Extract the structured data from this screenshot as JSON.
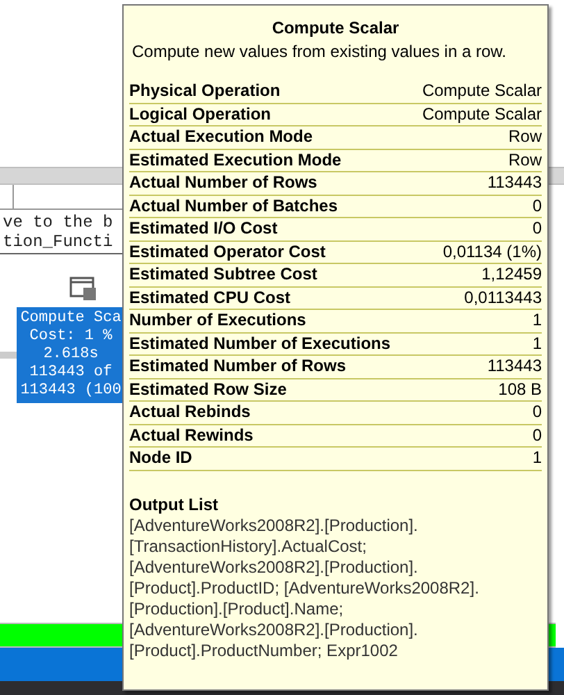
{
  "code_lines": [
    "ve to the b",
    "tion_Functi"
  ],
  "plan_node": {
    "lines": [
      "Compute Sca",
      "Cost: 1 %",
      "2.618s",
      "113443 of",
      "113443 (100"
    ],
    "selected": true
  },
  "tooltip": {
    "title": "Compute Scalar",
    "description": "Compute new values from existing values in a row.",
    "properties": [
      {
        "label": "Physical Operation",
        "value": "Compute Scalar"
      },
      {
        "label": "Logical Operation",
        "value": "Compute Scalar"
      },
      {
        "label": "Actual Execution Mode",
        "value": "Row"
      },
      {
        "label": "Estimated Execution Mode",
        "value": "Row"
      },
      {
        "label": "Actual Number of Rows",
        "value": "113443"
      },
      {
        "label": "Actual Number of Batches",
        "value": "0"
      },
      {
        "label": "Estimated I/O Cost",
        "value": "0"
      },
      {
        "label": "Estimated Operator Cost",
        "value": "0,01134 (1%)"
      },
      {
        "label": "Estimated Subtree Cost",
        "value": "1,12459"
      },
      {
        "label": "Estimated CPU Cost",
        "value": "0,0113443"
      },
      {
        "label": "Number of Executions",
        "value": "1"
      },
      {
        "label": "Estimated Number of Executions",
        "value": "1"
      },
      {
        "label": "Estimated Number of Rows",
        "value": "113443"
      },
      {
        "label": "Estimated Row Size",
        "value": "108 B"
      },
      {
        "label": "Actual Rebinds",
        "value": "0"
      },
      {
        "label": "Actual Rewinds",
        "value": "0"
      },
      {
        "label": "Node ID",
        "value": "1"
      }
    ],
    "output_list": {
      "title": "Output List",
      "lines": [
        "[AdventureWorks2008R2].[Production].",
        "[TransactionHistory].ActualCost;",
        "[AdventureWorks2008R2].[Production].",
        "[Product].ProductID; [AdventureWorks2008R2].",
        "[Production].[Product].Name;",
        "[AdventureWorks2008R2].[Production].",
        "[Product].ProductNumber; Expr1002"
      ]
    }
  }
}
